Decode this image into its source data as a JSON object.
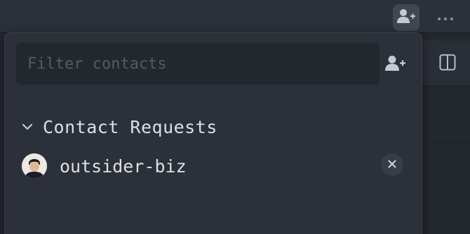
{
  "titlebar": {
    "add_contact_icon": "user-plus-icon",
    "more_icon": "ellipsis-icon"
  },
  "toolbar": {
    "split_icon": "split-pane-icon"
  },
  "popover": {
    "filter": {
      "placeholder": "Filter contacts",
      "value": ""
    },
    "add_contact_icon": "user-plus-icon",
    "sections": [
      {
        "title": "Contact Requests",
        "expanded": true,
        "items": [
          {
            "name": "outsider-biz",
            "action_icon": "close-icon"
          }
        ]
      }
    ]
  },
  "colors": {
    "panel_bg": "#2c3038",
    "input_bg": "#23272e",
    "text": "#dce0e5",
    "placeholder": "#555b66",
    "icon": "#b8bec8"
  }
}
